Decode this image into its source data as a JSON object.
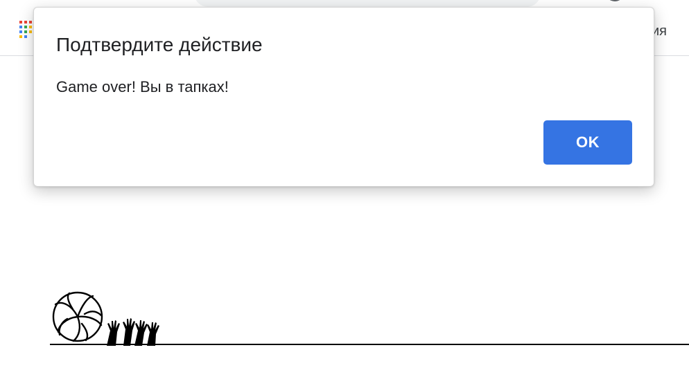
{
  "browser": {
    "bookmark_tail_text": "ия",
    "apps_icon": "apps-grid-icon",
    "profile_icon": "profile-icon"
  },
  "dialog": {
    "title": "Подтвердите действие",
    "message": "Game over! Вы в тапках!",
    "ok_label": "OK"
  },
  "game": {
    "ball_icon": "volleyball-icon",
    "players_icon": "raised-hands-icon"
  },
  "colors": {
    "accent": "#3574e3",
    "text": "#202124",
    "ground": "#000000"
  }
}
